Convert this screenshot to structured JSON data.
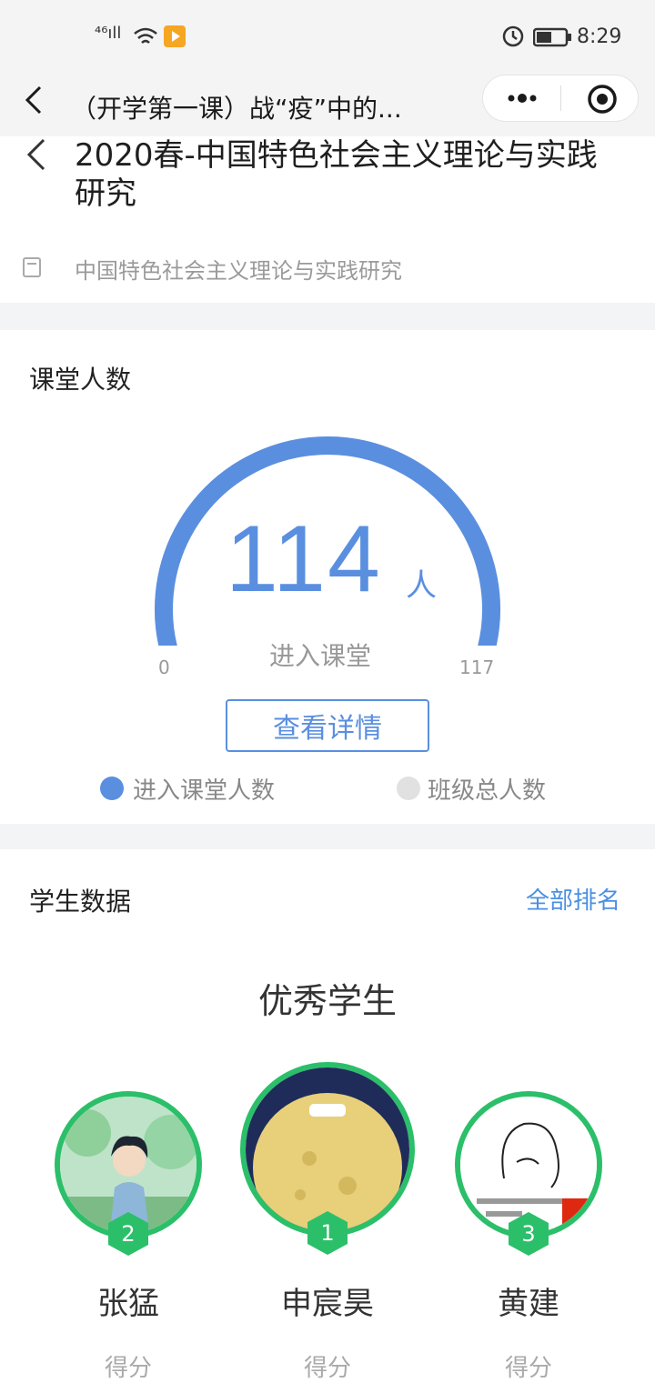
{
  "status_bar": {
    "time": "8:29",
    "signal": "⁴⁶ıll"
  },
  "nav": {
    "title": "（开学第一课）战“疫”中的..."
  },
  "course": {
    "title": "2020春-中国特色社会主义理论与实践研究",
    "subtitle": "中国特色社会主义理论与实践研究"
  },
  "attendance": {
    "section_title": "课堂人数",
    "count": "114",
    "unit": "人",
    "caption": "进入课堂",
    "min_label": "0",
    "max_label": "117",
    "entered": 114,
    "total": 117,
    "detail_button": "查看详情",
    "legend": [
      {
        "label": "进入课堂人数",
        "color": "#5a8fe0"
      },
      {
        "label": "班级总人数",
        "color": "#e1e1e1"
      }
    ]
  },
  "students": {
    "section_title": "学生数据",
    "all_ranking": "全部排名",
    "excellent_title": "优秀学生",
    "top": [
      {
        "rank": "2",
        "name": "张猛",
        "score_label": "得分"
      },
      {
        "rank": "1",
        "name": "申宸昊",
        "score_label": "得分"
      },
      {
        "rank": "3",
        "name": "黄建",
        "score_label": "得分"
      }
    ]
  },
  "colors": {
    "accent": "#5a8fe0",
    "rank": "#2cbf6a",
    "link": "#4a90e2"
  }
}
